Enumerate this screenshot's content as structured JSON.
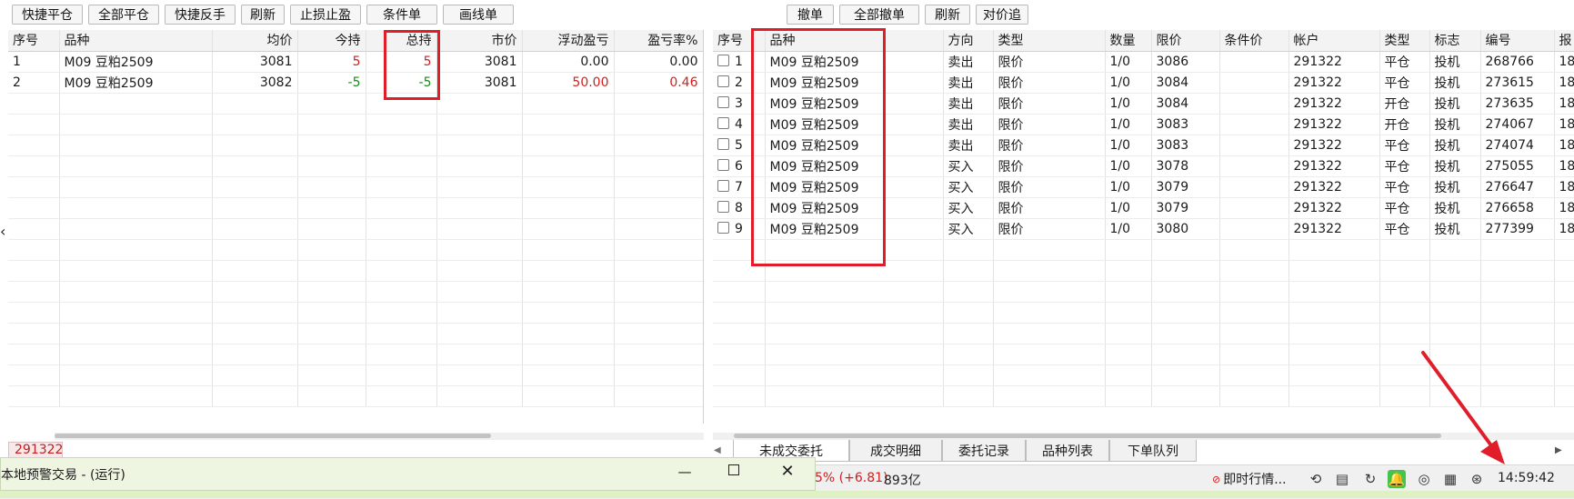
{
  "left_toolbar": [
    "快捷平仓",
    "全部平仓",
    "快捷反手",
    "刷新",
    "止损止盈",
    "条件单",
    "画线单"
  ],
  "right_toolbar": [
    "撤单",
    "全部撤单",
    "刷新",
    "对价追"
  ],
  "positions": {
    "headers": [
      "序号",
      "品种",
      "均价",
      "今持",
      "总持",
      "市价",
      "浮动盈亏",
      "盈亏率%"
    ],
    "rows": [
      {
        "idx": "1",
        "name": "M09 豆粕2509",
        "avg": "3081",
        "today": "5",
        "total": "5",
        "market": "3081",
        "pnl": "0.00",
        "rate": "0.00"
      },
      {
        "idx": "2",
        "name": "M09 豆粕2509",
        "avg": "3082",
        "today": "-5",
        "total": "-5",
        "market": "3081",
        "pnl": "50.00",
        "rate": "0.46"
      }
    ]
  },
  "orders": {
    "headers": [
      "序号",
      "品种",
      "方向",
      "类型",
      "数量",
      "限价",
      "条件价",
      "帐户",
      "类型",
      "标志",
      "编号",
      "报"
    ],
    "rows": [
      {
        "idx": "1",
        "name": "M09 豆粕2509",
        "dir": "卖出",
        "type": "限价",
        "qty": "1/0",
        "price": "3086",
        "cond": "",
        "acct": "291322",
        "kind": "平仓",
        "flag": "投机",
        "no": "268766",
        "extra": "18"
      },
      {
        "idx": "2",
        "name": "M09 豆粕2509",
        "dir": "卖出",
        "type": "限价",
        "qty": "1/0",
        "price": "3084",
        "cond": "",
        "acct": "291322",
        "kind": "平仓",
        "flag": "投机",
        "no": "273615",
        "extra": "18"
      },
      {
        "idx": "3",
        "name": "M09 豆粕2509",
        "dir": "卖出",
        "type": "限价",
        "qty": "1/0",
        "price": "3084",
        "cond": "",
        "acct": "291322",
        "kind": "开仓",
        "flag": "投机",
        "no": "273635",
        "extra": "18"
      },
      {
        "idx": "4",
        "name": "M09 豆粕2509",
        "dir": "卖出",
        "type": "限价",
        "qty": "1/0",
        "price": "3083",
        "cond": "",
        "acct": "291322",
        "kind": "开仓",
        "flag": "投机",
        "no": "274067",
        "extra": "18"
      },
      {
        "idx": "5",
        "name": "M09 豆粕2509",
        "dir": "卖出",
        "type": "限价",
        "qty": "1/0",
        "price": "3083",
        "cond": "",
        "acct": "291322",
        "kind": "平仓",
        "flag": "投机",
        "no": "274074",
        "extra": "18"
      },
      {
        "idx": "6",
        "name": "M09 豆粕2509",
        "dir": "买入",
        "type": "限价",
        "qty": "1/0",
        "price": "3078",
        "cond": "",
        "acct": "291322",
        "kind": "平仓",
        "flag": "投机",
        "no": "275055",
        "extra": "18"
      },
      {
        "idx": "7",
        "name": "M09 豆粕2509",
        "dir": "买入",
        "type": "限价",
        "qty": "1/0",
        "price": "3079",
        "cond": "",
        "acct": "291322",
        "kind": "平仓",
        "flag": "投机",
        "no": "276647",
        "extra": "18"
      },
      {
        "idx": "8",
        "name": "M09 豆粕2509",
        "dir": "买入",
        "type": "限价",
        "qty": "1/0",
        "price": "3079",
        "cond": "",
        "acct": "291322",
        "kind": "平仓",
        "flag": "投机",
        "no": "276658",
        "extra": "18"
      },
      {
        "idx": "9",
        "name": "M09 豆粕2509",
        "dir": "买入",
        "type": "限价",
        "qty": "1/0",
        "price": "3080",
        "cond": "",
        "acct": "291322",
        "kind": "平仓",
        "flag": "投机",
        "no": "277399",
        "extra": "18"
      }
    ]
  },
  "account_tab": "291322",
  "bottom_tabs": [
    "未成交委托",
    "成交明细",
    "委托记录",
    "品种列表",
    "下单队列"
  ],
  "window": {
    "title": "本地预警交易 - (运行)"
  },
  "status": {
    "index_change": "5% (+6.81)",
    "volume": "893亿",
    "quote": "即时行情...",
    "time": "14:59:42"
  },
  "colors": {
    "highlight": "#e11d2a",
    "positive": "#d01f1f",
    "negative": "#1a8a1a"
  }
}
